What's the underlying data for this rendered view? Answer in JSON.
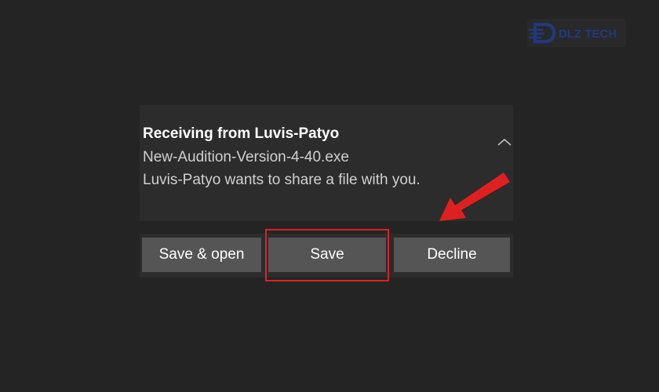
{
  "watermark": {
    "brand": "DLZ TECH",
    "color": "#1f3f8f"
  },
  "notification": {
    "title": "Receiving from Luvis-Patyo",
    "filename": "New-Audition-Version-4-40.exe",
    "message": "Luvis-Patyo wants to share a file with you.",
    "collapse_icon": "chevron-up-icon"
  },
  "actions": {
    "save_open": "Save & open",
    "save": "Save",
    "decline": "Decline"
  },
  "annotation": {
    "highlight_target": "save-button",
    "color": "#e02020",
    "arrow_icon": "red-arrow-icon"
  }
}
